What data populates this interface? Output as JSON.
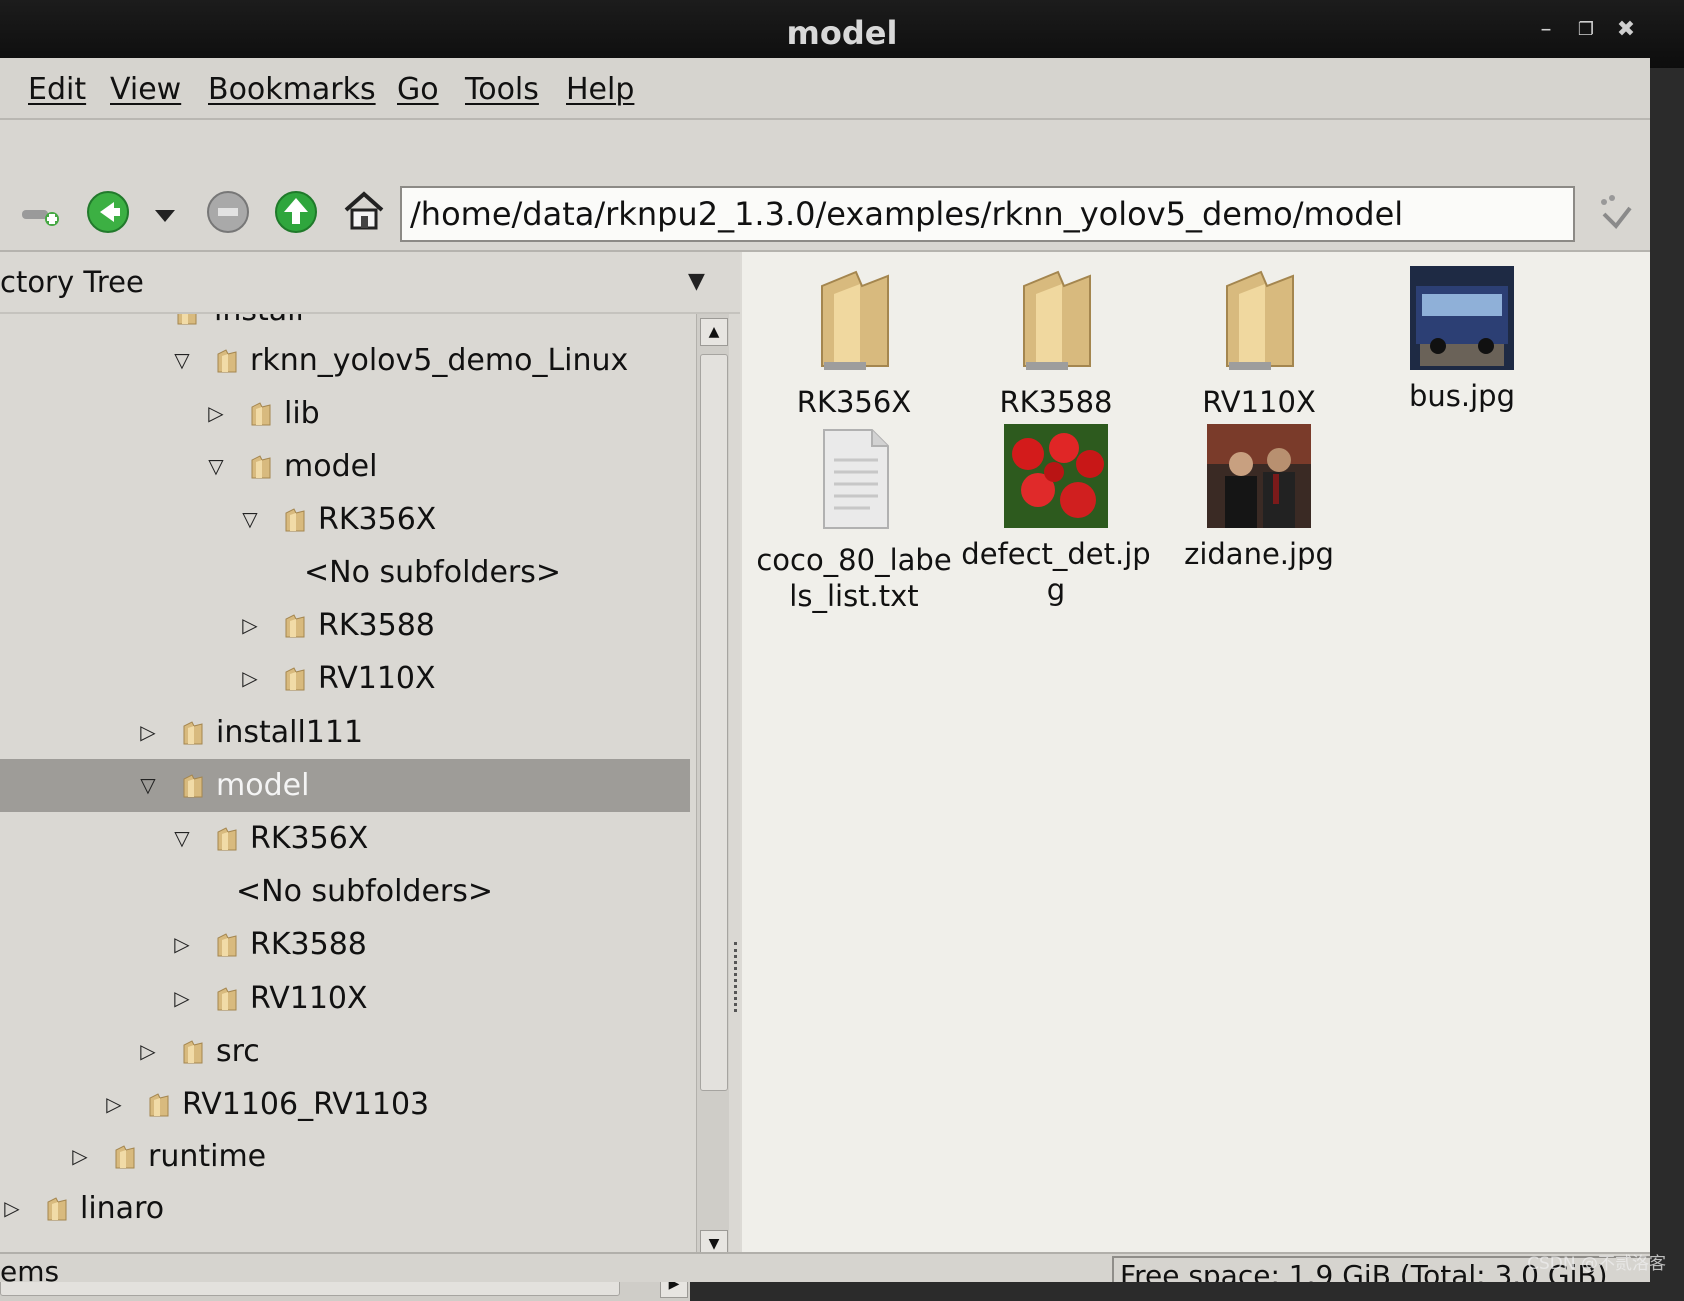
{
  "window": {
    "title": "model"
  },
  "menu": [
    "Edit",
    "View",
    "Bookmarks",
    "Go",
    "Tools",
    "Help"
  ],
  "location": {
    "path": "/home/data/rknpu2_1.3.0/examples/rknn_yolov5_demo/model"
  },
  "side_pane": {
    "header": "ctory Tree"
  },
  "tree": {
    "partial_top": "install",
    "rows": [
      {
        "label": "rknn_yolov5_demo_Linux",
        "expander": "open"
      },
      {
        "label": "lib",
        "expander": "closed"
      },
      {
        "label": "model",
        "expander": "open"
      },
      {
        "label": "RK356X",
        "expander": "open"
      },
      {
        "label": "<No subfolders>",
        "expander": "none"
      },
      {
        "label": "RK3588",
        "expander": "closed"
      },
      {
        "label": "RV110X",
        "expander": "closed"
      },
      {
        "label": "install111",
        "expander": "closed"
      },
      {
        "label": "model",
        "expander": "open",
        "selected": true
      },
      {
        "label": "RK356X",
        "expander": "open"
      },
      {
        "label": "<No subfolders>",
        "expander": "none"
      },
      {
        "label": "RK3588",
        "expander": "closed"
      },
      {
        "label": "RV110X",
        "expander": "closed"
      },
      {
        "label": "src",
        "expander": "closed"
      },
      {
        "label": "RV1106_RV1103",
        "expander": "closed"
      },
      {
        "label": "runtime",
        "expander": "closed"
      },
      {
        "label": "linaro",
        "expander": "closed"
      }
    ]
  },
  "files": [
    {
      "name": "RK356X",
      "type": "folder"
    },
    {
      "name": "RK3588",
      "type": "folder"
    },
    {
      "name": "RV110X",
      "type": "folder"
    },
    {
      "name": "bus.jpg",
      "type": "image"
    },
    {
      "name": "coco_80_labels_list.txt",
      "type": "text"
    },
    {
      "name": "defect_det.jpg",
      "type": "image"
    },
    {
      "name": "zidane.jpg",
      "type": "image"
    }
  ],
  "status": {
    "left": "ems",
    "right": "Free space: 1.9 GiB (Total: 3.0 GiB)"
  },
  "watermark": "CSDN @不贰洛客",
  "icons": {
    "toolbar": [
      "new-tab-icon",
      "back-icon",
      "dropdown-arrow-icon",
      "stop-icon",
      "up-icon",
      "home-icon",
      "go-icon"
    ],
    "folder_color": "#d8ba7e",
    "back_color": "#3cb043",
    "up_color": "#2fa63d"
  }
}
